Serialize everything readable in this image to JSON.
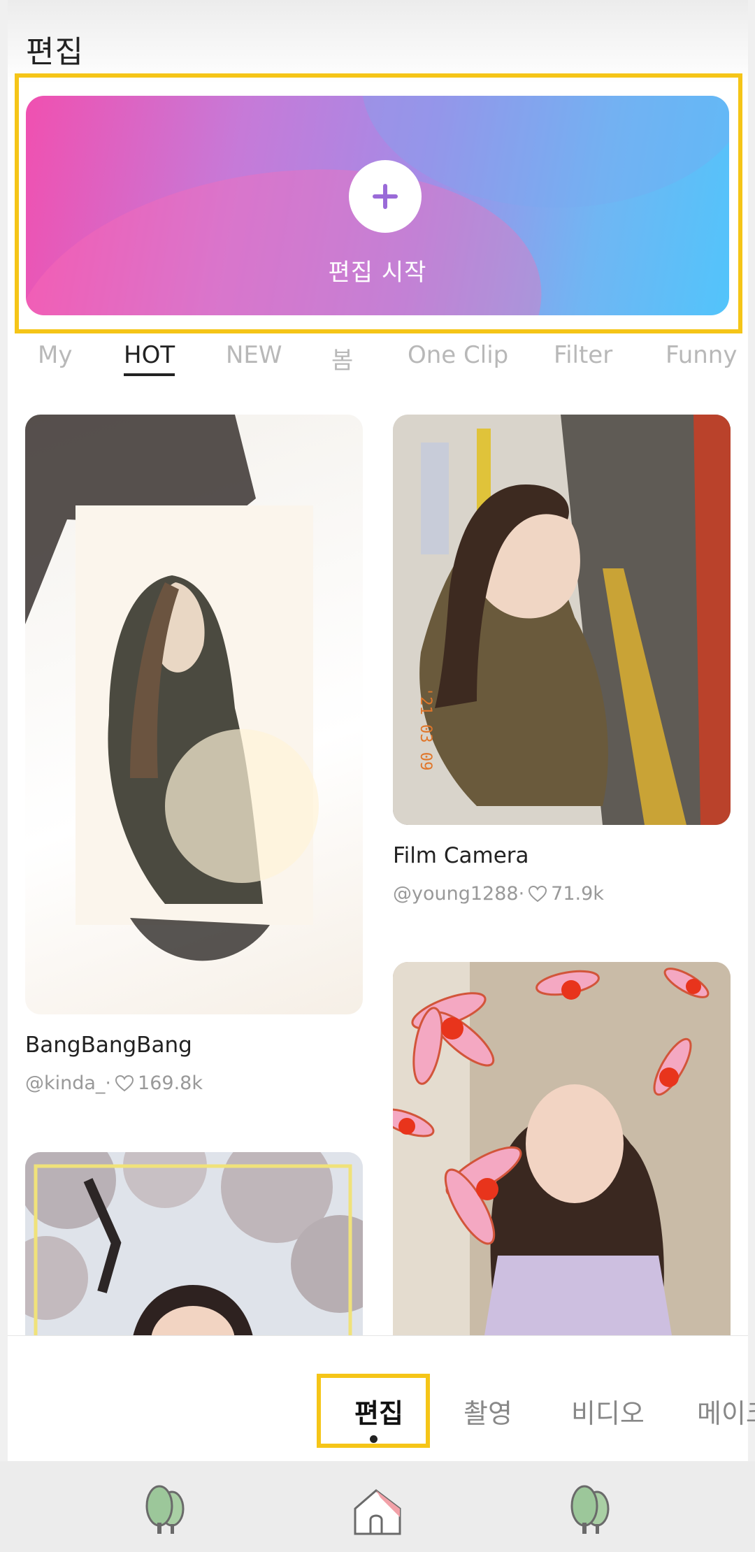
{
  "header": {
    "title": "편집"
  },
  "banner": {
    "label": "편집 시작",
    "gradient": [
      "#f050b0",
      "#a58be6",
      "#52c4fb"
    ]
  },
  "category_tabs": [
    {
      "label": "My"
    },
    {
      "label": "HOT",
      "active": true
    },
    {
      "label": "NEW"
    },
    {
      "label": "봄"
    },
    {
      "label": "One Clip"
    },
    {
      "label": "Filter"
    },
    {
      "label": "Funny"
    }
  ],
  "cards": [
    {
      "title": "BangBangBang",
      "author": "@kinda_·",
      "likes": "169.8k"
    },
    {
      "title": "Film Camera",
      "author": "@young1288·",
      "likes": "71.9k",
      "photo_stamp": "'21 03 09"
    },
    {
      "title": "",
      "author": "",
      "likes": ""
    },
    {
      "title": "",
      "author": "",
      "likes": ""
    }
  ],
  "modes": [
    {
      "label": "편집",
      "active": true
    },
    {
      "label": "촬영"
    },
    {
      "label": "비디오"
    },
    {
      "label": "메이크"
    }
  ],
  "system_nav": {
    "buttons": [
      "tree-icon",
      "home-icon",
      "tree-icon"
    ]
  },
  "colors": {
    "highlight": "#f5c518",
    "active_text": "#222222",
    "inactive_text": "#b8b8b8"
  }
}
